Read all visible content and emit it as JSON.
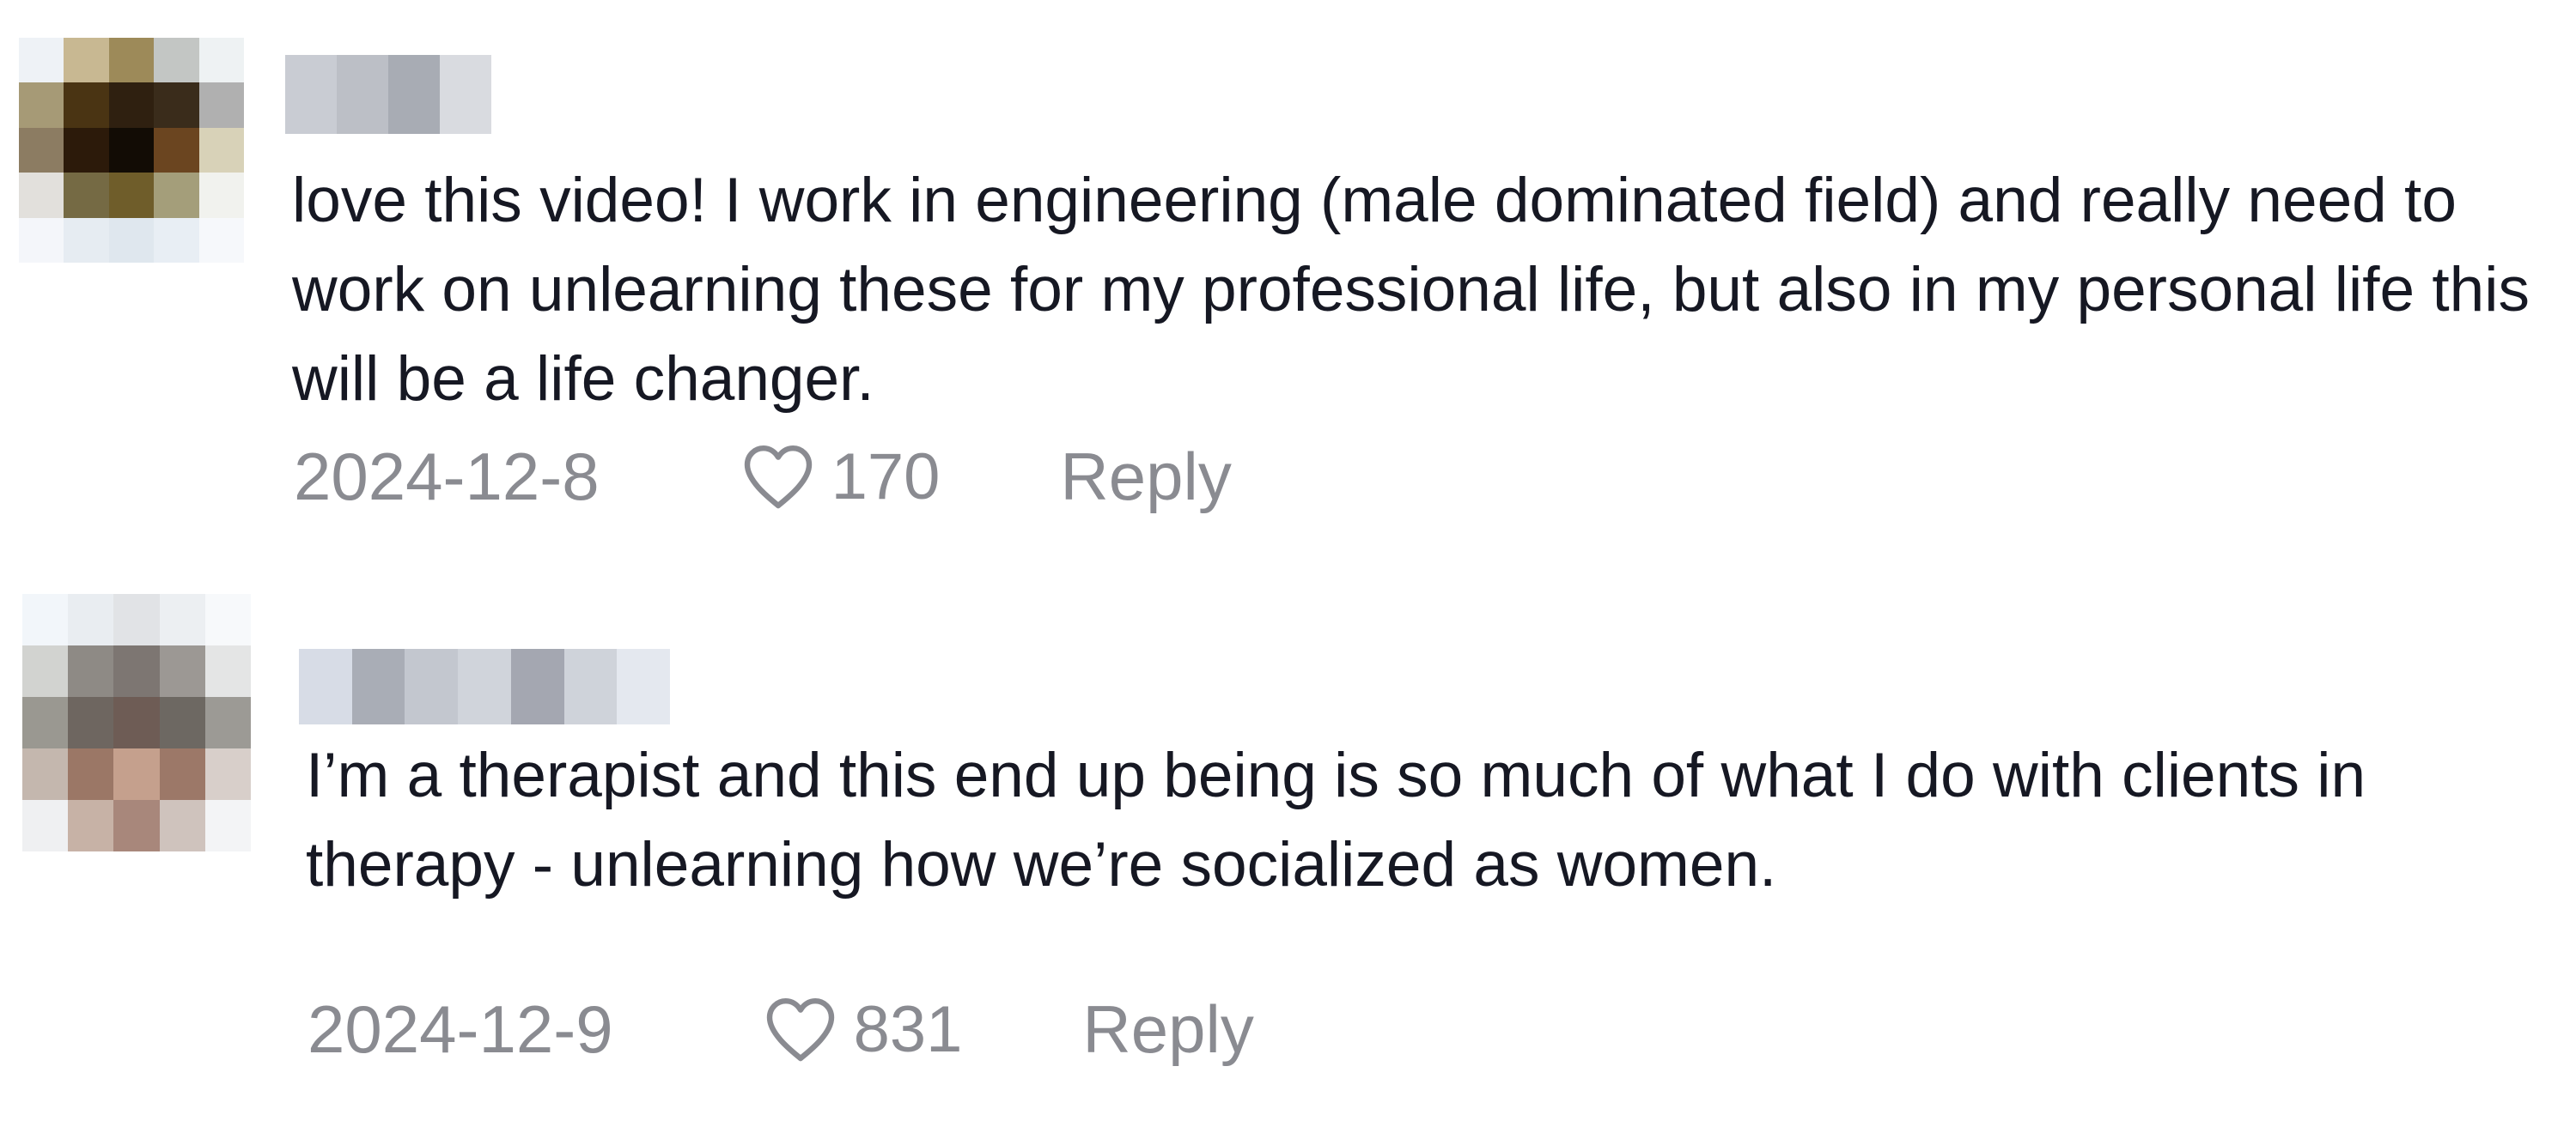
{
  "comments": [
    {
      "text": "love this video! I work in engineering (male dominated field) and really need to work on unlearning these for my professional life, but also in my personal life this will be a life changer.",
      "date": "2024-12-8",
      "likes": "170",
      "reply_label": "Reply",
      "avatar_pixels": [
        "#eef2f6",
        "#c8b892",
        "#9d8a59",
        "#c3c6c4",
        "#eef2f3",
        "#a69a76",
        "#4a3413",
        "#2f2010",
        "#3a2c1b",
        "#b0b0b0",
        "#8c7c62",
        "#2c1a0a",
        "#120c05",
        "#6b4520",
        "#d8d2b8",
        "#e2e0dc",
        "#756a44",
        "#6f5d2a",
        "#a49e7a",
        "#f1f2ee",
        "#f4f6fa",
        "#e6ecf2",
        "#dfe7ee",
        "#e8eef4",
        "#f6f8fb"
      ],
      "username_blocks": [
        "#c9ccd3",
        "#bcbfc6",
        "#a8acb4",
        "#d9dbe0"
      ]
    },
    {
      "text": "I’m a therapist and this end up being is so much of what I do with clients in therapy - unlearning how we’re socialized as women.",
      "date": "2024-12-9",
      "likes": "831",
      "reply_label": "Reply",
      "avatar_pixels": [
        "#f2f6fa",
        "#e9edf1",
        "#e1e3e6",
        "#eceff2",
        "#f7f9fb",
        "#d2d3d0",
        "#8e8a85",
        "#7d7672",
        "#9c9894",
        "#e4e5e5",
        "#9a9891",
        "#6e6660",
        "#6e5c55",
        "#6d6862",
        "#9c9a95",
        "#c4b7ae",
        "#9b7766",
        "#c5a08d",
        "#9c7868",
        "#d8cfca",
        "#eff0f2",
        "#c7b2a6",
        "#a8877b",
        "#cfc3bd",
        "#f3f4f6"
      ],
      "username_blocks": [
        "#d7dce6",
        "#a9adb6",
        "#c3c7cf",
        "#d0d4db",
        "#a4a7b1",
        "#cfd3da",
        "#e4e8ef"
      ]
    }
  ]
}
